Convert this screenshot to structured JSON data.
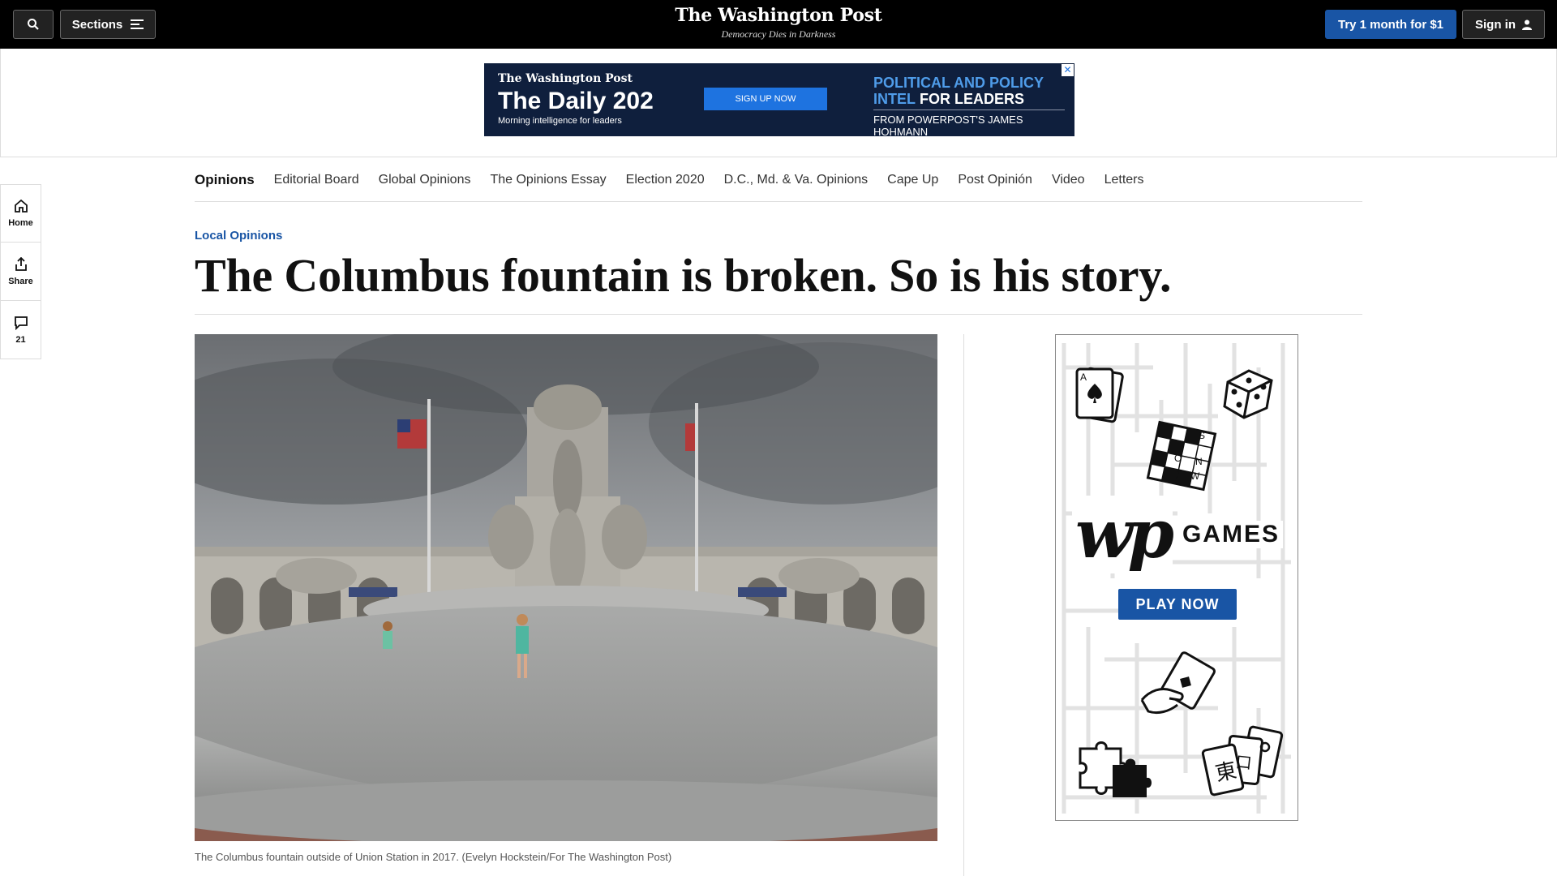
{
  "header": {
    "sections_label": "Sections",
    "masthead_title": "The Washington Post",
    "tagline": "Democracy Dies in Darkness",
    "try_label": "Try 1 month for $1",
    "signin_label": "Sign in"
  },
  "ad_top": {
    "brand": "The Washington Post",
    "title": "The Daily 202",
    "subtitle": "Morning intelligence for leaders",
    "button": "SIGN UP NOW",
    "right_line1": "POLITICAL AND POLICY",
    "right_line2_blue": "INTEL",
    "right_line2_white": " FOR LEADERS",
    "right_line3": "FROM POWERPOST'S JAMES HOHMANN",
    "close": "✕"
  },
  "rail": {
    "home": "Home",
    "share": "Share",
    "comments": "21"
  },
  "section_nav": [
    "Opinions",
    "Editorial Board",
    "Global Opinions",
    "The Opinions Essay",
    "Election 2020",
    "D.C., Md. & Va. Opinions",
    "Cape Up",
    "Post Opinión",
    "Video",
    "Letters"
  ],
  "article": {
    "kicker": "Local Opinions",
    "headline": "The Columbus fountain is broken. So is his story.",
    "caption": "The Columbus fountain outside of Union Station in 2017. (Evelyn Hockstein/For The Washington Post)"
  },
  "games_ad": {
    "logo": "wp",
    "label": "GAMES",
    "button": "PLAY NOW",
    "crossword_letters": [
      "S",
      "O",
      "N",
      "W"
    ]
  },
  "colors": {
    "accent_blue": "#1955a5",
    "topbar_bg": "#000000",
    "ad_navy": "#0f1f3d"
  }
}
